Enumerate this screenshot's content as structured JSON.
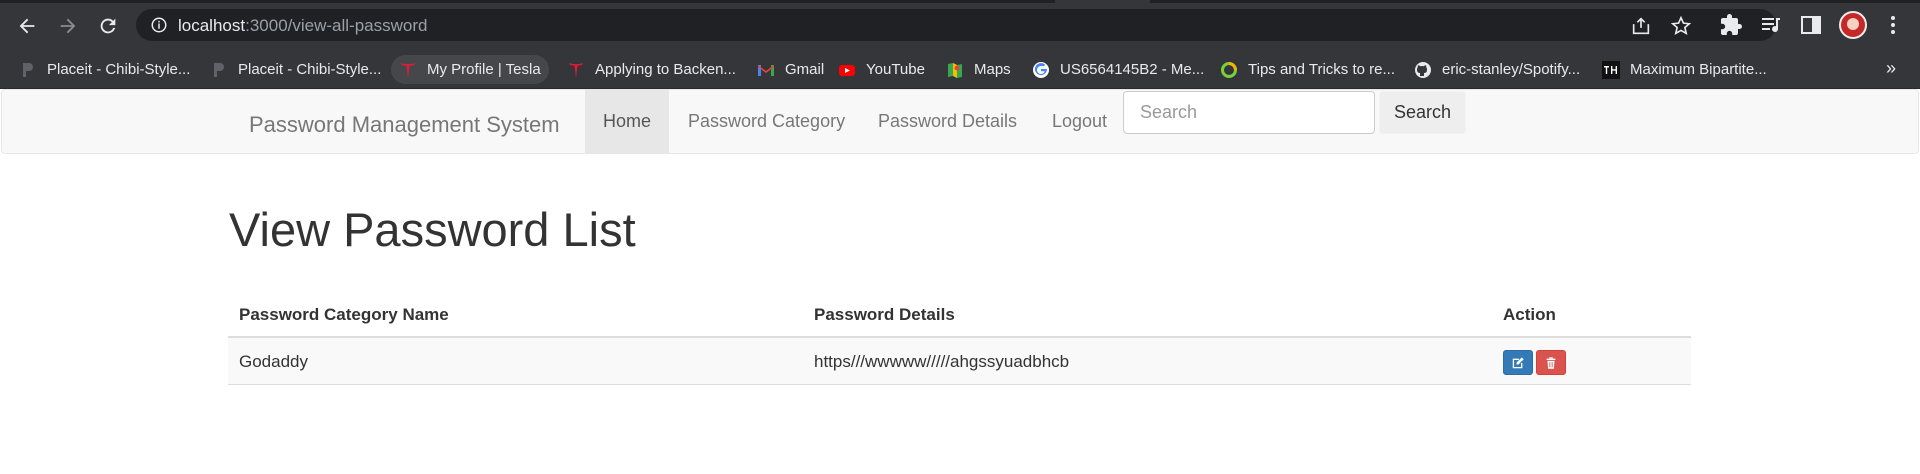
{
  "browser": {
    "url_host": "localhost",
    "url_path": ":3000/view-all-password",
    "bookmarks": [
      {
        "label": "Placeit - Chibi-Style...",
        "icon": "placeit-icon"
      },
      {
        "label": "Placeit - Chibi-Style...",
        "icon": "placeit-icon"
      },
      {
        "label": "My Profile | Tesla",
        "icon": "tesla-icon"
      },
      {
        "label": "Applying to Backen...",
        "icon": "tesla-icon"
      },
      {
        "label": "Gmail",
        "icon": "gmail-icon"
      },
      {
        "label": "YouTube",
        "icon": "youtube-icon"
      },
      {
        "label": "Maps",
        "icon": "maps-icon"
      },
      {
        "label": "US6564145B2 - Me...",
        "icon": "google-icon"
      },
      {
        "label": "Tips and Tricks to re...",
        "icon": "ring-icon"
      },
      {
        "label": "eric-stanley/Spotify...",
        "icon": "github-icon"
      },
      {
        "label": "Maximum Bipartite...",
        "icon": "th-icon"
      }
    ],
    "more": "»"
  },
  "navbar": {
    "brand": "Password Management System",
    "items": [
      {
        "label": "Home",
        "active": true
      },
      {
        "label": "Password Category",
        "active": false
      },
      {
        "label": "Password Details",
        "active": false
      },
      {
        "label": "Logout",
        "active": false
      }
    ],
    "search_placeholder": "Search",
    "search_button": "Search"
  },
  "main": {
    "title": "View Password List",
    "table": {
      "headers": [
        "Password Category Name",
        "Password Details",
        "Action"
      ],
      "rows": [
        {
          "category": "Godaddy",
          "details": "https///wwwww/////ahgssyuadbhcb"
        }
      ]
    }
  },
  "colors": {
    "primary": "#337ab7",
    "danger": "#d9534f",
    "navbar_bg": "#f8f8f8"
  }
}
